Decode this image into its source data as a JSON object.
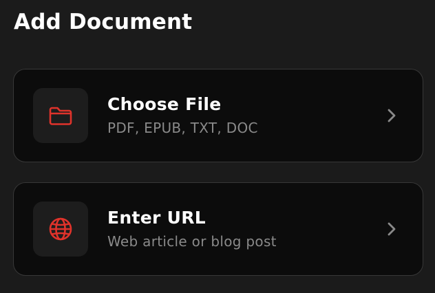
{
  "header": {
    "title": "Add Document"
  },
  "options": [
    {
      "title": "Choose File",
      "subtitle": "PDF, EPUB, TXT, DOC",
      "icon": "folder-icon"
    },
    {
      "title": "Enter URL",
      "subtitle": "Web article or blog post",
      "icon": "globe-icon"
    }
  ],
  "colors": {
    "background": "#1b1b1b",
    "card_background": "#0c0c0c",
    "card_border": "#383838",
    "icon_tile": "#1d1d1d",
    "accent": "#e0332b",
    "subtitle_text": "#8a8a8a",
    "chevron": "#8a8a8a"
  }
}
